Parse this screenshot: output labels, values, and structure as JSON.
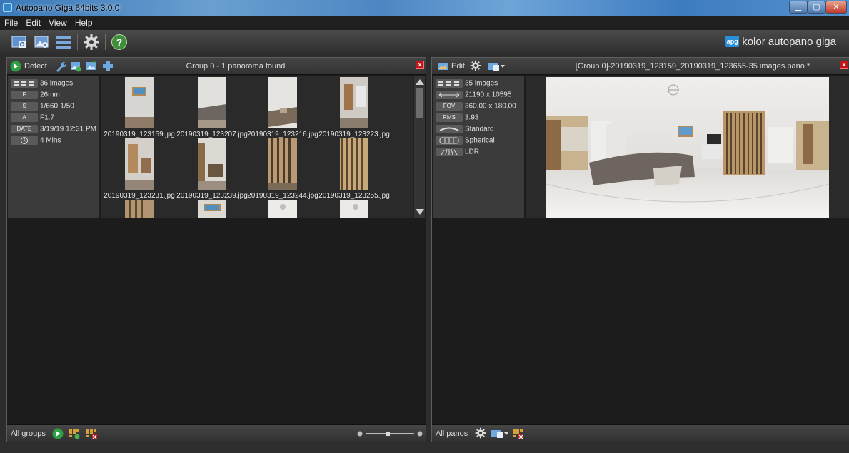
{
  "window": {
    "title": "Autopano Giga 64bits 3.0.0",
    "controls": [
      "minimize",
      "maximize",
      "close"
    ]
  },
  "menu": [
    {
      "label": "File"
    },
    {
      "label": "Edit"
    },
    {
      "label": "View"
    },
    {
      "label": "Help"
    }
  ],
  "toolbar": {
    "icons": [
      "open-folder-icon",
      "import-images-icon",
      "batch-icon",
      "settings-gear-icon",
      "help-icon"
    ],
    "brand": {
      "mark": "apg",
      "text": "kolor autopano giga"
    }
  },
  "left_panel": {
    "header": {
      "detect_label": "Detect",
      "title": "Group 0 - 1 panorama found",
      "close": "×"
    },
    "info": {
      "images": "36 images",
      "focal": {
        "tag": "F",
        "value": "26mm"
      },
      "shutter": {
        "tag": "S",
        "value": "1/660-1/50"
      },
      "aperture": {
        "tag": "A",
        "value": "F1.7"
      },
      "date": {
        "tag": "DATE",
        "value": "3/19/19 12:31 PM"
      },
      "duration": "4 Mins"
    },
    "thumbnails": [
      {
        "label": "20190319_123159.jpg"
      },
      {
        "label": "20190319_123207.jpg"
      },
      {
        "label": "20190319_123216.jpg"
      },
      {
        "label": "20190319_123223.jpg"
      },
      {
        "label": "20190319_123231.jpg"
      },
      {
        "label": "20190319_123239.jpg"
      },
      {
        "label": "20190319_123244.jpg"
      },
      {
        "label": "20190319_123255.jpg"
      }
    ],
    "footer": {
      "label": "All groups"
    }
  },
  "right_panel": {
    "header": {
      "edit_label": "Edit",
      "title": "[Group 0]-20190319_123159_20190319_123655-35 images.pano *",
      "close": "×"
    },
    "info": {
      "images": "35 images",
      "size": "21190 x 10595",
      "fov": {
        "tag": "FOV",
        "value": "360.00 x 180.00"
      },
      "rms": {
        "tag": "RMS",
        "value": "3.93"
      },
      "color": "Standard",
      "projection": "Spherical",
      "range": "LDR"
    },
    "footer": {
      "label": "All panos"
    }
  },
  "colors": {
    "background": "#2d2d2d",
    "panel": "#1c1c1c",
    "accent": "#2a8ed8",
    "close": "#c0181a",
    "detect_green": "#2ea043"
  }
}
